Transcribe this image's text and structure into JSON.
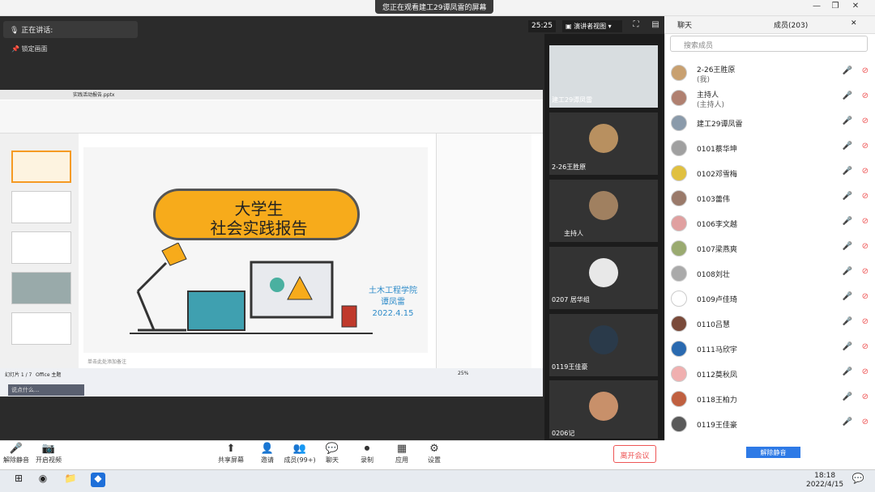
{
  "window": {
    "viewing_banner": "您正在观看建工29谭凤雷的屏幕"
  },
  "meeting": {
    "talking_label": "正在讲话:",
    "lock_label": "锁定画面",
    "timer": "25:25",
    "presenter_view": "演讲者视图"
  },
  "slide": {
    "title_line1": "大学生",
    "title_line2": "社会实践报告",
    "school": "土木工程学院",
    "author": "谭凤雷",
    "date": "2022.4.15"
  },
  "ppt": {
    "file_tab": "实践活动报告.pptx",
    "page_indicator": "幻灯片 1 / 7",
    "theme": "Office 主题",
    "zoom": "25%",
    "notes_hint": "单击此处添加备注",
    "say_hint": "说点什么..."
  },
  "tiles": [
    {
      "name": "建工29谭凤雷"
    },
    {
      "name": "2-26王胜原"
    },
    {
      "name": "主持人"
    },
    {
      "name": "0207 居华组"
    },
    {
      "name": "0119王佳豪"
    },
    {
      "name": "0206记"
    }
  ],
  "panel": {
    "tab_chat": "聊天",
    "tab_members": "成员(203)",
    "search_placeholder": "搜索成员",
    "unmute_all": "解除静音",
    "members": [
      {
        "name": "2-26王胜原",
        "sub": "(我)",
        "color": "#c8a070"
      },
      {
        "name": "主持人",
        "sub": "(主持人)",
        "color": "#b08070"
      },
      {
        "name": "建工29谭凤雷",
        "sub": "",
        "color": "#8a9aaa"
      },
      {
        "name": "0101蔡华坤",
        "sub": "",
        "color": "#a0a0a0"
      },
      {
        "name": "0102邓雪梅",
        "sub": "",
        "color": "#e0c040"
      },
      {
        "name": "0103蕾伟",
        "sub": "",
        "color": "#9a7a6a"
      },
      {
        "name": "0106李文越",
        "sub": "",
        "color": "#e0a0a0"
      },
      {
        "name": "0107梁燕爽",
        "sub": "",
        "color": "#9aaa70"
      },
      {
        "name": "0108刘壮",
        "sub": "",
        "color": "#aaaaaa"
      },
      {
        "name": "0109卢佳琦",
        "sub": "",
        "color": "#ffffff"
      },
      {
        "name": "0110吕慧",
        "sub": "",
        "color": "#7a4a3a"
      },
      {
        "name": "0111马欣宇",
        "sub": "",
        "color": "#2a6ab0"
      },
      {
        "name": "0112莫秋凤",
        "sub": "",
        "color": "#f0b0b0"
      },
      {
        "name": "0118王柏力",
        "sub": "",
        "color": "#c06040"
      },
      {
        "name": "0119王佳豪",
        "sub": "",
        "color": "#5a5a5a"
      }
    ]
  },
  "controls": [
    {
      "label": "解除静音",
      "icon": "🎤"
    },
    {
      "label": "开启视频",
      "icon": "📷"
    },
    {
      "label": "共享屏幕",
      "icon": "⬆"
    },
    {
      "label": "邀请",
      "icon": "👤"
    },
    {
      "label": "成员(99+)",
      "icon": "👥"
    },
    {
      "label": "聊天",
      "icon": "💬"
    },
    {
      "label": "录制",
      "icon": "⏺"
    },
    {
      "label": "应用",
      "icon": "▦"
    },
    {
      "label": "设置",
      "icon": "⚙"
    }
  ],
  "leave_label": "离开会议",
  "clock": {
    "time": "18:18",
    "date": "2022/4/15"
  }
}
